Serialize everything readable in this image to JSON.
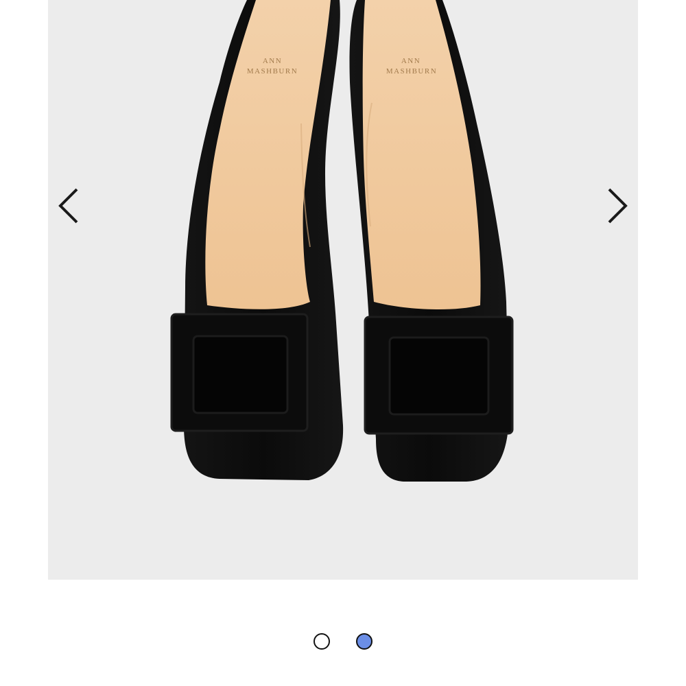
{
  "gallery": {
    "image_brand": "ANN MASHBURN",
    "image_brand_line1": "ANN",
    "image_brand_line2": "MASHBURN",
    "prev_icon": "chevron-left-icon",
    "next_icon": "chevron-right-icon",
    "slide_count": 2,
    "active_slide": 2
  },
  "colors": {
    "frame_background": "#ececec",
    "active_dot": "#6b8ee6",
    "shoe_upper": "#0e0e0e",
    "insole": "#f0c9a0"
  }
}
